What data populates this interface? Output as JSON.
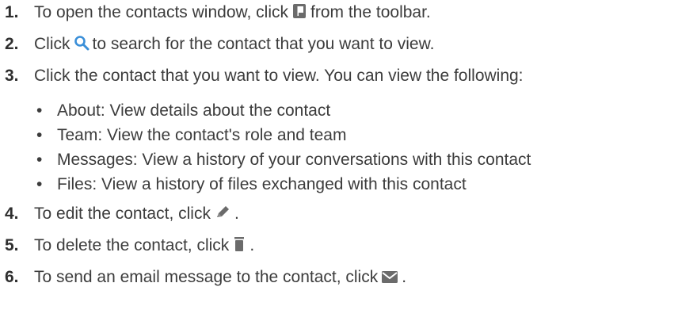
{
  "steps": [
    {
      "num": "1.",
      "before": "To open the contacts window, click",
      "icon": "contacts-book-icon",
      "after": "from the toolbar."
    },
    {
      "num": "2.",
      "before": "Click",
      "icon": "search-icon",
      "after": "to search for the contact that you want to view."
    },
    {
      "num": "3.",
      "text": "Click the contact that you want to view. You can view the following:",
      "subitems": [
        "About: View details about the contact",
        "Team: View the contact's role and team",
        "Messages: View a history of your conversations with this contact",
        "Files: View a history of files exchanged with this contact"
      ]
    },
    {
      "num": "4.",
      "before": "To edit the contact, click",
      "icon": "pencil-icon",
      "after": "."
    },
    {
      "num": "5.",
      "before": "To delete the contact, click",
      "icon": "trash-icon",
      "after": "."
    },
    {
      "num": "6.",
      "before": "To send an email message to the contact, click",
      "icon": "envelope-icon",
      "after": "."
    }
  ],
  "colors": {
    "text": "#3c3c3c",
    "icon": "#6b6b6b",
    "search_icon": "#3a8fd8"
  }
}
